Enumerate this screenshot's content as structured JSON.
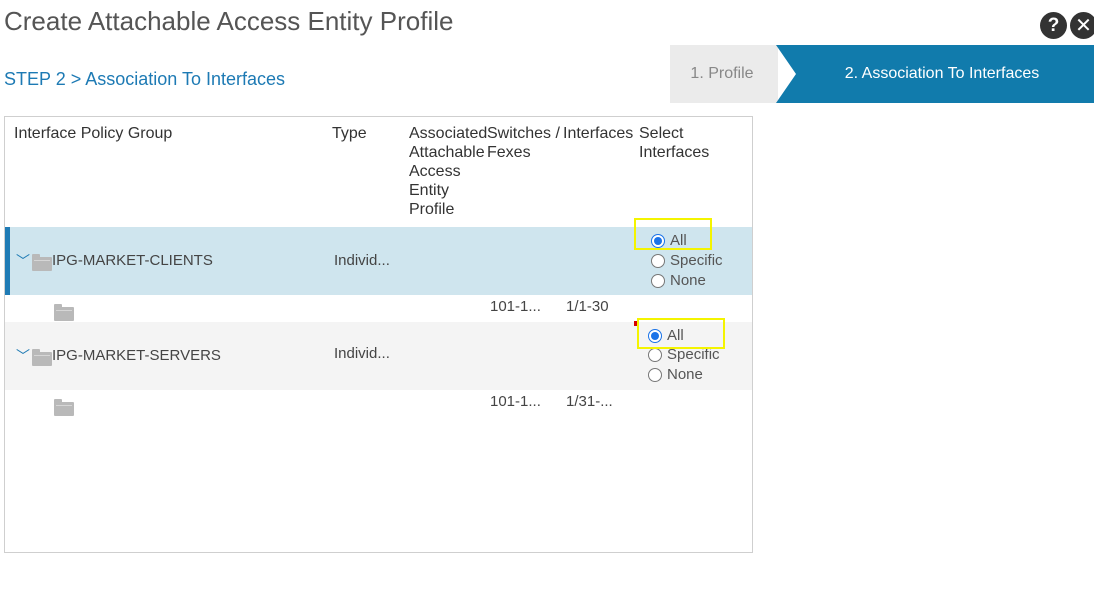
{
  "dialog": {
    "title": "Create Attachable Access Entity Profile",
    "help_label": "?",
    "close_label": "✕",
    "step_label": "STEP 2 > Association To Interfaces"
  },
  "wizard": {
    "steps": [
      {
        "label": "1. Profile",
        "active": false
      },
      {
        "label": "2. Association To Interfaces",
        "active": true
      }
    ]
  },
  "table": {
    "columns": {
      "policy_group": "Interface Policy Group",
      "type": "Type",
      "aaep": "Associated Attachable Access Entity Profile",
      "switches": "Switches / Fexes",
      "interfaces": "Interfaces",
      "select": "Select Interfaces"
    },
    "radio_options": {
      "all": "All",
      "specific": "Specific",
      "none": "None"
    },
    "rows": [
      {
        "name": "IPG-MARKET-CLIENTS",
        "type": "Individ...",
        "selected_option": "All",
        "child": {
          "switches": "101-1...",
          "interfaces": "1/1-30"
        }
      },
      {
        "name": "IPG-MARKET-SERVERS",
        "type": "Individ...",
        "selected_option": "All",
        "child": {
          "switches": "101-1...",
          "interfaces": "1/31-..."
        }
      }
    ]
  },
  "colors": {
    "accent": "#117bac",
    "selected_row": "#cfe5ee",
    "highlight": "#f4f400"
  },
  "icons": [
    "help-icon",
    "close-icon",
    "chevron-down-icon",
    "folder-icon"
  ]
}
